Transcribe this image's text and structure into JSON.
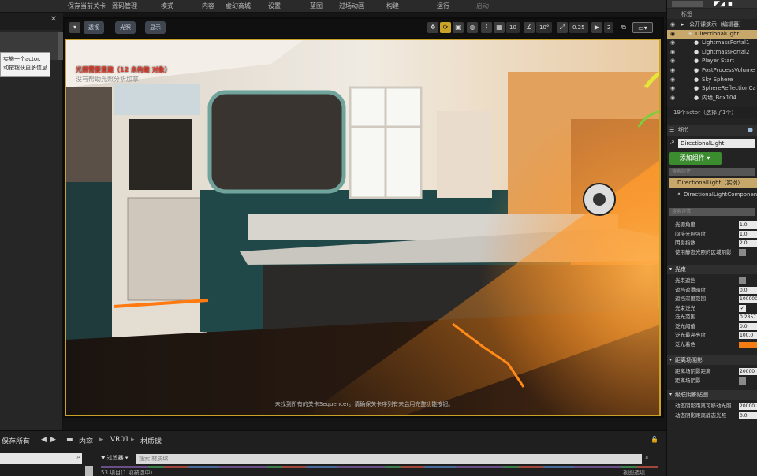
{
  "toolbar": {
    "items": [
      "保存当前关卡",
      "源码管理",
      "模式",
      "内容",
      "虚幻商城",
      "设置",
      "蓝图",
      "过场动画",
      "构建",
      "运行",
      "启动"
    ]
  },
  "left_panel": {
    "close_glyph": "✕",
    "tooltip": [
      "实施一个actor.",
      "动按钮获更多信息"
    ]
  },
  "viewport": {
    "toolbar": {
      "perspective": "透视",
      "lit": "光照",
      "show": "显示",
      "snap_grid": "10",
      "snap_rotation": "10°",
      "snap_scale": "0.25",
      "camera_speed": "2"
    },
    "warning": "光照需要重建（12 未构建 对象）",
    "warning_sub": "没有帮助光照分析加拿",
    "hint": "未找到所有的关卡Sequencer。请确保关卡序列有来启用完整功能按钮。"
  },
  "content_browser": {
    "save_all": "保存所有",
    "path": [
      "内容",
      "VR01",
      "材质球"
    ],
    "filters_label": "过滤器",
    "search_placeholder": "搜索 材质球",
    "status": "53 项目(1 项被选中)",
    "view_options": "视图选项"
  },
  "outliner": {
    "header": "标签",
    "items": [
      {
        "label": "公开课演示（编辑器）",
        "icon": "folder",
        "indent": 0
      },
      {
        "label": "DirectionalLight",
        "icon": "light",
        "indent": 1,
        "selected": true
      },
      {
        "label": "LightmassPortal1",
        "icon": "dot",
        "indent": 2
      },
      {
        "label": "LightmassPortal2",
        "icon": "dot",
        "indent": 2
      },
      {
        "label": "Player Start",
        "icon": "dot",
        "indent": 2
      },
      {
        "label": "PostProcessVolume",
        "icon": "dot",
        "indent": 2
      },
      {
        "label": "Sky Sphere",
        "icon": "dot",
        "indent": 2
      },
      {
        "label": "SphereReflectionCa",
        "icon": "dot",
        "indent": 2
      },
      {
        "label": "内墙_Box104",
        "icon": "dot",
        "indent": 2
      }
    ],
    "count": "19个actor（选择了1个）"
  },
  "details": {
    "tab": "细节",
    "name": "DirectionalLight",
    "add_component": "+添加组件 ▾",
    "component_search": "搜索组件",
    "component_instance": "DirectionalLight（实例）",
    "component_child": "DirectionalLightComponent",
    "property_search": "搜索详情",
    "props_top": [
      {
        "label": "光源角度",
        "type": "value",
        "value": "1.0"
      },
      {
        "label": "间接光照强度",
        "type": "value",
        "value": "1.0"
      },
      {
        "label": "阴影指数",
        "type": "value",
        "value": "2.0"
      },
      {
        "label": "使用静态光照的区域阴影",
        "type": "check",
        "value": false
      }
    ],
    "section_light": "光束",
    "props_light": [
      {
        "label": "光束遮挡",
        "type": "check",
        "value": false
      },
      {
        "label": "遮挡遮罩暗度",
        "type": "value",
        "value": "0.0"
      },
      {
        "label": "遮挡深度范围",
        "type": "value",
        "value": "100000"
      },
      {
        "label": "光束泛光",
        "type": "check",
        "value": true
      },
      {
        "label": "泛光范围",
        "type": "value",
        "value": "0.2857"
      },
      {
        "label": "泛光阈值",
        "type": "value",
        "value": "0.0"
      },
      {
        "label": "泛光最高亮度",
        "type": "value",
        "value": "100.0"
      },
      {
        "label": "泛光着色",
        "type": "color",
        "value": "#f57c13"
      }
    ],
    "section_distance": "距离场阴影",
    "props_distance": [
      {
        "label": "距离场阴影距离",
        "type": "value",
        "value": "20000"
      },
      {
        "label": "距离场阴影",
        "type": "check",
        "value": false
      }
    ],
    "section_cascade": "级联阴影贴图",
    "props_cascade": [
      {
        "label": "动态阴影距离可移动光照",
        "type": "value",
        "value": "20000"
      },
      {
        "label": "动态阴影距离静态光照",
        "type": "value",
        "value": "0.0"
      }
    ]
  },
  "colors": {
    "selection_gold": "#c7a86a",
    "add_component_green": "#3b8b2f",
    "warning_red": "#e23b2b",
    "viewport_border": "#c9a227"
  }
}
